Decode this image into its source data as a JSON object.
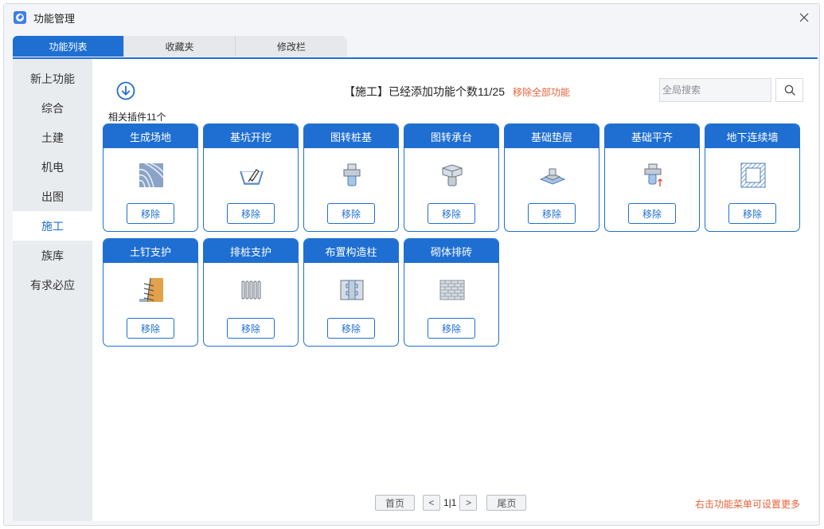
{
  "window": {
    "title": "功能管理",
    "accent": "#1f6fd2",
    "warn_color": "#e8623a"
  },
  "tabs": [
    {
      "label": "功能列表",
      "active": true
    },
    {
      "label": "收藏夹",
      "active": false
    },
    {
      "label": "修改栏",
      "active": false
    }
  ],
  "sidebar": {
    "items": [
      {
        "label": "新上功能"
      },
      {
        "label": "综合"
      },
      {
        "label": "土建"
      },
      {
        "label": "机电"
      },
      {
        "label": "出图"
      },
      {
        "label": "施工",
        "active": true
      },
      {
        "label": "族库"
      },
      {
        "label": "有求必应"
      }
    ]
  },
  "header": {
    "status_text": "【施工】已经添加功能个数11/25",
    "remove_all_label": "移除全部功能",
    "search_placeholder": "全局搜索",
    "count_label": "相关插件11个"
  },
  "cards": [
    {
      "title": "生成场地",
      "icon": "terrain-contour-icon",
      "button": "移除"
    },
    {
      "title": "基坑开挖",
      "icon": "excavation-pit-icon",
      "button": "移除"
    },
    {
      "title": "图转桩基",
      "icon": "pile-cap-icon",
      "button": "移除"
    },
    {
      "title": "图转承台",
      "icon": "pile-platform-icon",
      "button": "移除"
    },
    {
      "title": "基础垫层",
      "icon": "foundation-cushion-icon",
      "button": "移除"
    },
    {
      "title": "基础平齐",
      "icon": "foundation-align-icon",
      "button": "移除"
    },
    {
      "title": "地下连续墙",
      "icon": "diaphragm-wall-icon",
      "button": "移除"
    },
    {
      "title": "土钉支护",
      "icon": "soil-nail-icon",
      "button": "移除"
    },
    {
      "title": "排桩支护",
      "icon": "pile-row-icon",
      "button": "移除"
    },
    {
      "title": "布置构造柱",
      "icon": "structural-column-icon",
      "button": "移除"
    },
    {
      "title": "砌体排砖",
      "icon": "brick-wall-icon",
      "button": "移除"
    }
  ],
  "pager": {
    "first": "首页",
    "prev": "<",
    "page": "1|1",
    "next": ">",
    "last": "尾页"
  },
  "footer_hint": "右击功能菜单可设置更多"
}
